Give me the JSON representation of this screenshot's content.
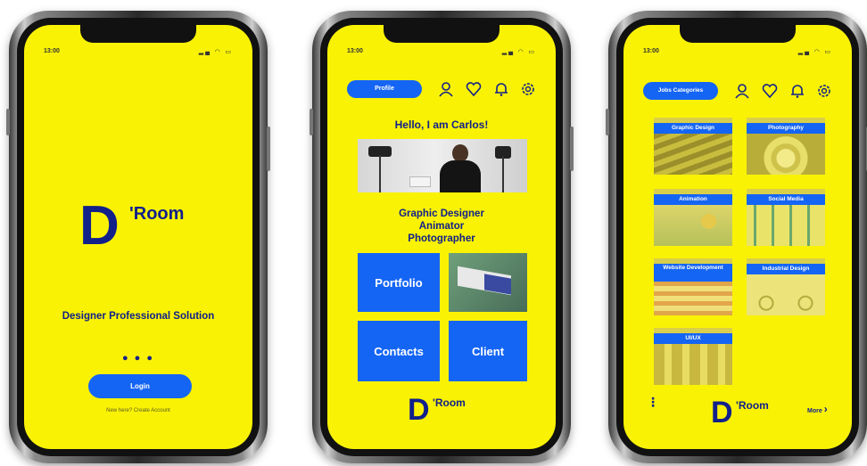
{
  "colors": {
    "screen_bg": "#f9f205",
    "accent_blue": "#1565f4",
    "logo_navy": "#12208a"
  },
  "status": {
    "time": "13:00",
    "icons": "signal wifi battery"
  },
  "brand": {
    "letter": "D",
    "suffix": "'Room"
  },
  "screen1": {
    "tagline": "Designer Professional Solution",
    "dots": "● ● ●",
    "login_label": "Login",
    "signup_text": "New here? Create Account"
  },
  "screen2": {
    "profile_button": "Profile",
    "greeting": "Hello, I am Carlos!",
    "roles": [
      "Graphic Designer",
      "Animator",
      "Photographer"
    ],
    "tiles": {
      "portfolio": "Portfolio",
      "contacts": "Contacts",
      "client": "Client"
    },
    "header_icons": [
      "user-icon",
      "heart-icon",
      "bell-icon",
      "gear-icon"
    ]
  },
  "screen3": {
    "category_button": "Jobs Categories",
    "categories": [
      "Graphic Design",
      "Photography",
      "Animation",
      "Social Media",
      "Website Development",
      "Industrial Design",
      "UI/UX"
    ],
    "more_label": "More",
    "menu_icon": "kebab-menu-icon"
  }
}
